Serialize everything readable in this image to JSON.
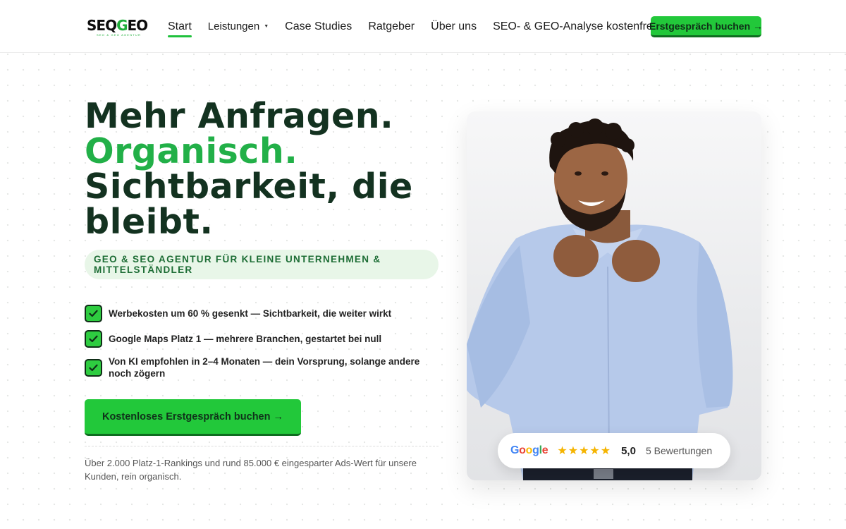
{
  "header": {
    "logo_text_part1": "SEQ",
    "logo_text_green": "G",
    "logo_text_part2": "EO",
    "logo_tagline": "SEO & GEO AGENTUR",
    "nav": [
      {
        "label": "Start",
        "active": true
      },
      {
        "label": "Leistungen",
        "has_dropdown": true
      },
      {
        "label": "Case Studies"
      },
      {
        "label": "Ratgeber"
      },
      {
        "label": "Über uns"
      },
      {
        "label": "SEO- & GEO-Analyse kostenfrei"
      }
    ],
    "cta_label": "Erstgespräch buchen →"
  },
  "hero": {
    "headline": {
      "line1": "Mehr Anfragen.",
      "line2": "Organisch.",
      "line3": "Sichtbarkeit, die",
      "line4": "bleibt."
    },
    "tagline": "GEO & SEO AGENTUR FÜR KLEINE UNTERNEHMEN & MITTELSTÄNDLER",
    "bullets": [
      "Werbekosten um 60 % gesenkt — Sichtbarkeit, die weiter wirkt",
      "Google Maps Platz 1 — mehrere Branchen, gestartet bei null",
      "Von KI empfohlen in 2–4 Monaten — dein Vorsprung, solange andere noch zögern"
    ],
    "cta_label": "Kostenloses Erstgespräch buchen →",
    "subnote": "Über 2.000 Platz-1-Rankings und rund 85.000 € eingesparter Ads-Wert für unsere Kunden, rein organisch."
  },
  "review_badge": {
    "google_letters": [
      "G",
      "o",
      "o",
      "g",
      "l",
      "e"
    ],
    "stars": "★★★★★",
    "star_count": 5,
    "rating": "5,0",
    "reviews_text": "5 Bewertungen"
  },
  "colors": {
    "accent_green": "#22c83a",
    "headline_dark": "#133220",
    "headline_green": "#22b048",
    "star_yellow": "#f5b400"
  },
  "icons": {
    "check": "check-icon",
    "dropdown": "chevron-down-icon",
    "arrow": "arrow-right-icon"
  }
}
